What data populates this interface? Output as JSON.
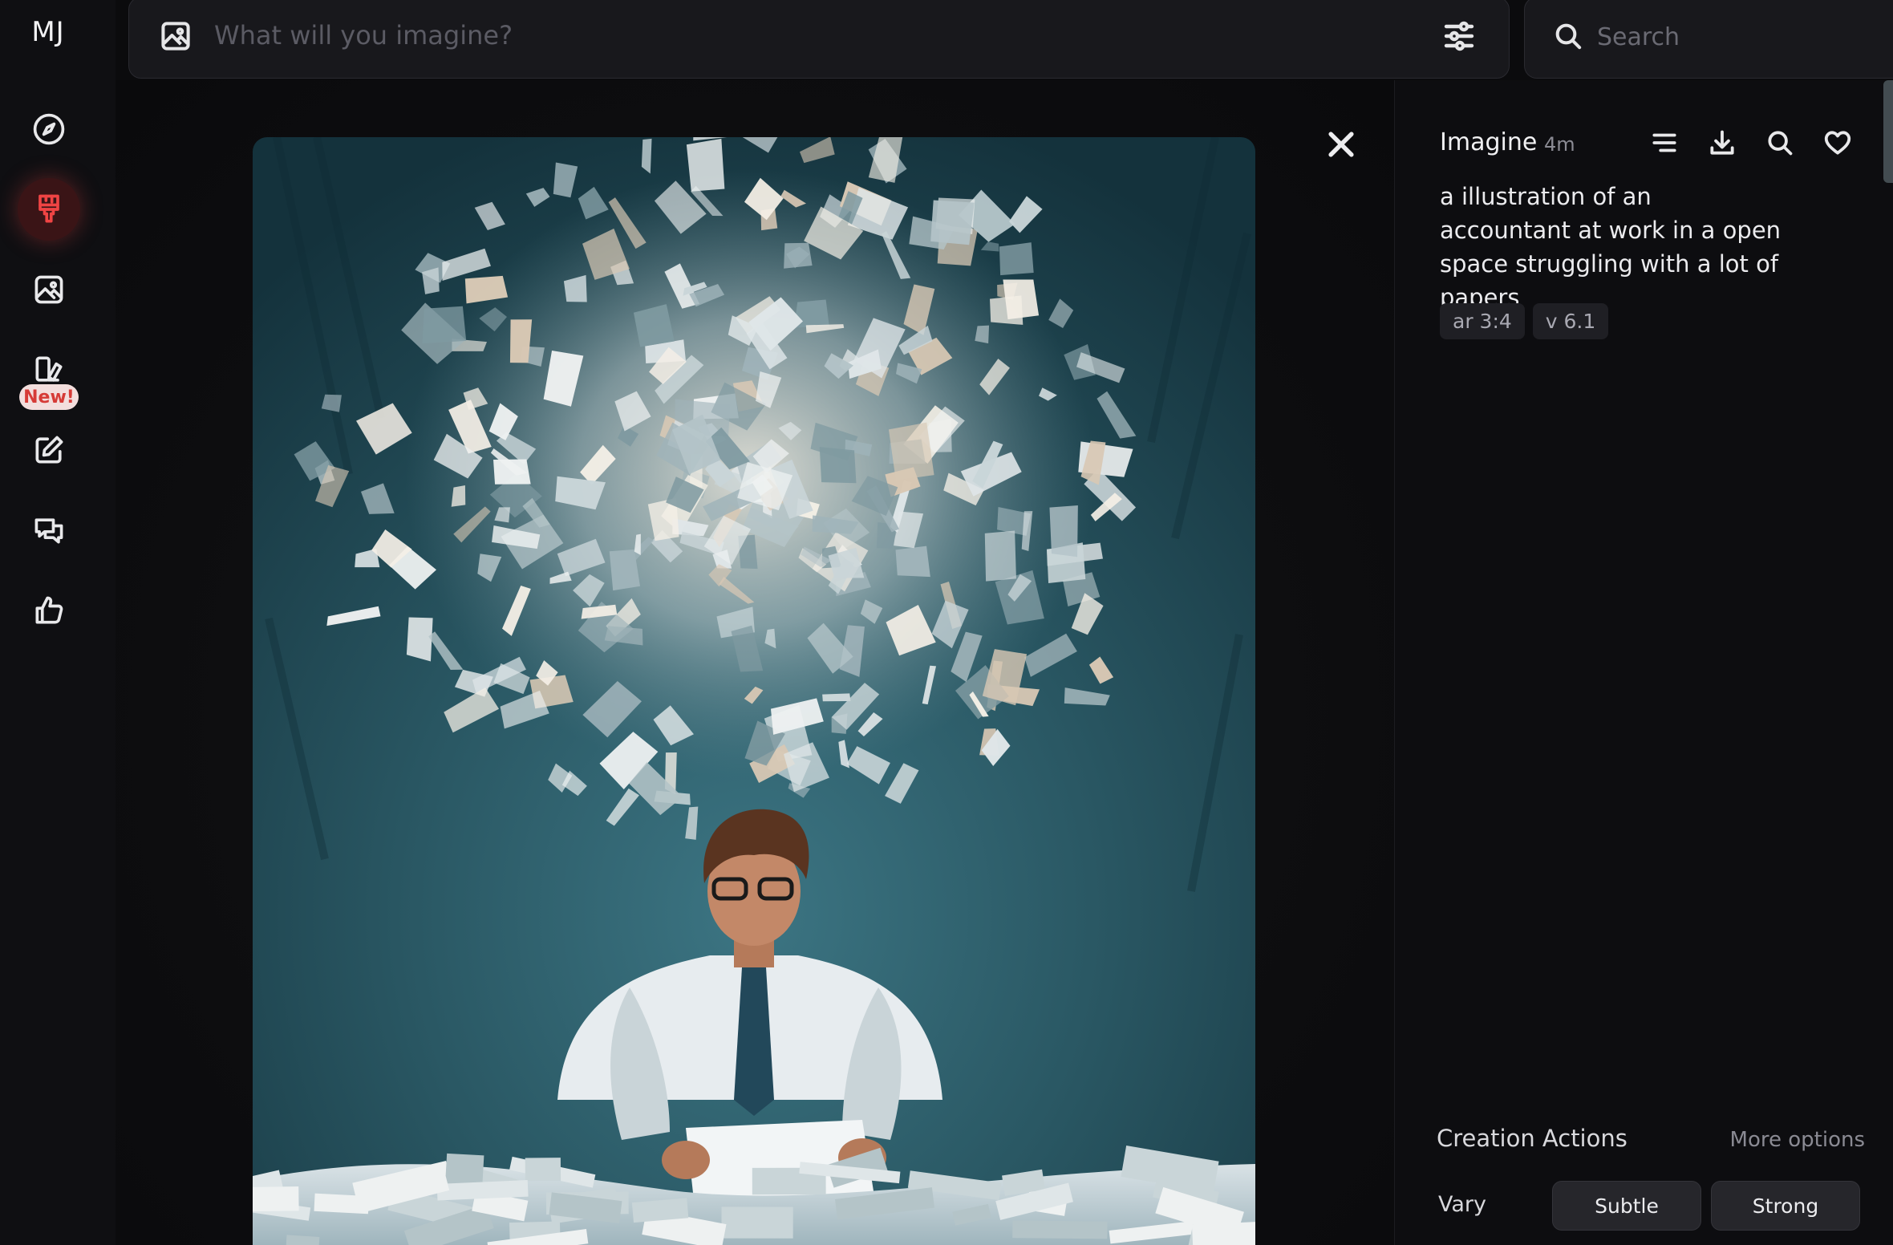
{
  "app": {
    "logo": "MJ"
  },
  "sidebar": {
    "items": [
      {
        "id": "explore",
        "icon": "compass-icon"
      },
      {
        "id": "create",
        "icon": "paintbrush-icon",
        "active": true
      },
      {
        "id": "organize",
        "icon": "image-icon"
      },
      {
        "id": "editor",
        "icon": "pen-tablet-icon",
        "badge": "New!"
      },
      {
        "id": "edit",
        "icon": "pencil-square-icon"
      },
      {
        "id": "chat",
        "icon": "chat-bubbles-icon"
      },
      {
        "id": "rank",
        "icon": "thumbs-up-icon"
      }
    ],
    "active_color": "#ef4444"
  },
  "topbar": {
    "prompt_placeholder": "What will you imagine?",
    "prompt_icon": "image-icon",
    "settings_icon": "sliders-icon"
  },
  "search": {
    "placeholder": "Search"
  },
  "viewer": {
    "close_icon": "close-icon",
    "image_description": "painting of an accountant reading papers beneath a storm of flying papers",
    "palette": {
      "background": "#254e5a",
      "shirt": "#e7ecef",
      "hair": "#5a3420",
      "tie": "#22485a"
    }
  },
  "details": {
    "title": "Imagine",
    "age": "4m",
    "icons": [
      "list-icon",
      "download-icon",
      "search-icon",
      "heart-icon"
    ],
    "prompt": "a illustration of an accountant at work in a open space struggling with a lot of papers",
    "params": [
      "ar 3:4",
      "v 6.1"
    ]
  },
  "actions": {
    "title": "Creation Actions",
    "more_options": "More options",
    "vary_label": "Vary",
    "vary_buttons": [
      "Subtle",
      "Strong"
    ]
  }
}
